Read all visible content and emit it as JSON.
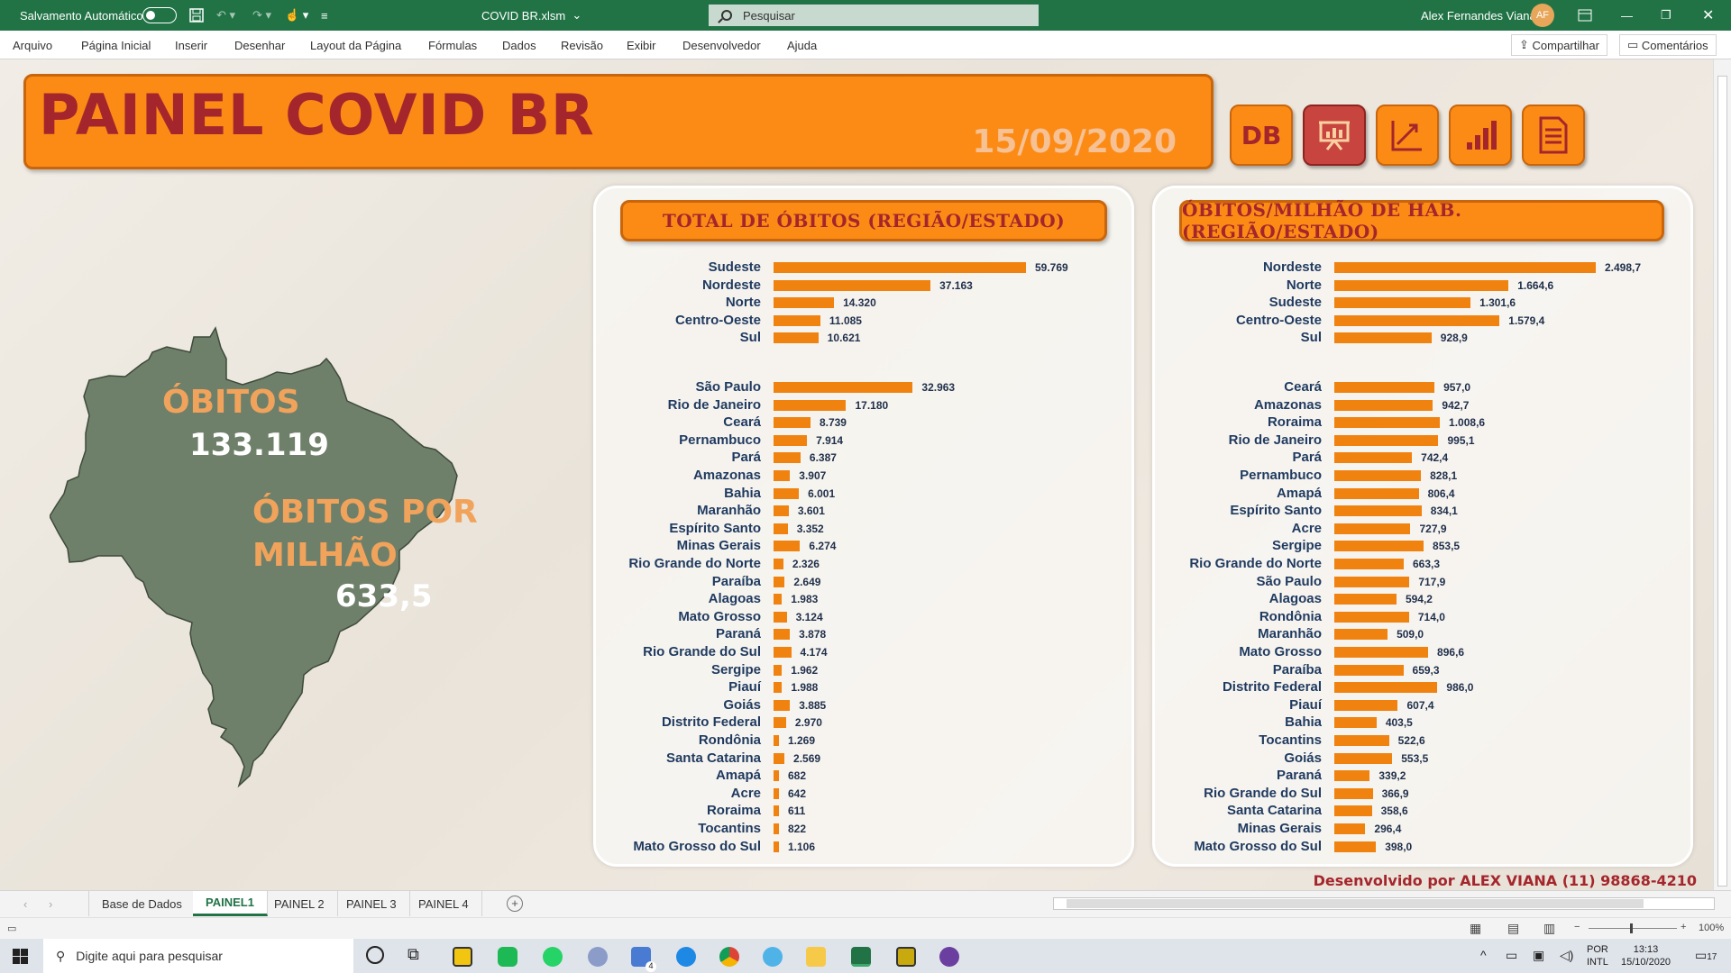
{
  "window": {
    "autosave_label": "Salvamento Automático",
    "file_name": "COVID BR.xlsm",
    "search_placeholder": "Pesquisar",
    "user_name": "Alex Fernandes Viana",
    "user_initials": "AF"
  },
  "ribbon": {
    "tabs": [
      "Arquivo",
      "Página Inicial",
      "Inserir",
      "Desenhar",
      "Layout da Página",
      "Fórmulas",
      "Dados",
      "Revisão",
      "Exibir",
      "Desenvolvedor",
      "Ajuda"
    ],
    "share_label": "Compartilhar",
    "comments_label": "Comentários"
  },
  "dashboard": {
    "title": "PAINEL COVID BR",
    "date": "15/09/2020",
    "db_button": "DB",
    "map": {
      "deaths_label": "ÓBITOS",
      "deaths_value": "133.119",
      "per_million_label_1": "ÓBITOS POR",
      "per_million_label_2": "MILHÃO",
      "per_million_value": "633,5"
    },
    "credit": "Desenvolvido por ALEX VIANA (11) 98868-4210"
  },
  "chart_data": [
    {
      "type": "bar",
      "title": "TOTAL DE ÓBITOS (REGIÃO/ESTADO)",
      "orientation": "horizontal",
      "regions": {
        "categories": [
          "Sudeste",
          "Nordeste",
          "Norte",
          "Centro-Oeste",
          "Sul"
        ],
        "values": [
          59769,
          37163,
          14320,
          11085,
          10621
        ],
        "labels": [
          "59.769",
          "37.163",
          "14.320",
          "11.085",
          "10.621"
        ]
      },
      "states": {
        "categories": [
          "São Paulo",
          "Rio de Janeiro",
          "Ceará",
          "Pernambuco",
          "Pará",
          "Amazonas",
          "Bahia",
          "Maranhão",
          "Espírito Santo",
          "Minas Gerais",
          "Rio Grande do Norte",
          "Paraíba",
          "Alagoas",
          "Mato Grosso",
          "Paraná",
          "Rio Grande do Sul",
          "Sergipe",
          "Piauí",
          "Goiás",
          "Distrito Federal",
          "Rondônia",
          "Santa Catarina",
          "Amapá",
          "Acre",
          "Roraima",
          "Tocantins",
          "Mato Grosso do Sul"
        ],
        "values": [
          32963,
          17180,
          8739,
          7914,
          6387,
          3907,
          6001,
          3601,
          3352,
          6274,
          2326,
          2649,
          1983,
          3124,
          3878,
          4174,
          1962,
          1988,
          3885,
          2970,
          1269,
          2569,
          682,
          642,
          611,
          822,
          1106
        ],
        "labels": [
          "32.963",
          "17.180",
          "8.739",
          "7.914",
          "6.387",
          "3.907",
          "6.001",
          "3.601",
          "3.352",
          "6.274",
          "2.326",
          "2.649",
          "1.983",
          "3.124",
          "3.878",
          "4.174",
          "1.962",
          "1.988",
          "3.885",
          "2.970",
          "1.269",
          "2.569",
          "682",
          "642",
          "611",
          "822",
          "1.106"
        ]
      }
    },
    {
      "type": "bar",
      "title": "ÓBITOS/MILHÃO DE HAB. (REGIÃO/ESTADO)",
      "orientation": "horizontal",
      "regions": {
        "categories": [
          "Nordeste",
          "Norte",
          "Sudeste",
          "Centro-Oeste",
          "Sul"
        ],
        "values": [
          2498.7,
          1664.6,
          1301.6,
          1579.4,
          928.9
        ],
        "labels": [
          "2.498,7",
          "1.664,6",
          "1.301,6",
          "1.579,4",
          "928,9"
        ]
      },
      "states": {
        "categories": [
          "Ceará",
          "Amazonas",
          "Roraima",
          "Rio de Janeiro",
          "Pará",
          "Pernambuco",
          "Amapá",
          "Espírito Santo",
          "Acre",
          "Sergipe",
          "Rio Grande do Norte",
          "São Paulo",
          "Alagoas",
          "Rondônia",
          "Maranhão",
          "Mato Grosso",
          "Paraíba",
          "Distrito Federal",
          "Piauí",
          "Bahia",
          "Tocantins",
          "Goiás",
          "Paraná",
          "Rio Grande do Sul",
          "Santa Catarina",
          "Minas Gerais",
          "Mato Grosso do Sul"
        ],
        "values": [
          957.0,
          942.7,
          1008.6,
          995.1,
          742.4,
          828.1,
          806.4,
          834.1,
          727.9,
          853.5,
          663.3,
          717.9,
          594.2,
          714.0,
          509.0,
          896.6,
          659.3,
          986.0,
          607.4,
          403.5,
          522.6,
          553.5,
          339.2,
          366.9,
          358.6,
          296.4,
          398.0
        ],
        "labels": [
          "957,0",
          "942,7",
          "1.008,6",
          "995,1",
          "742,4",
          "828,1",
          "806,4",
          "834,1",
          "727,9",
          "853,5",
          "663,3",
          "717,9",
          "594,2",
          "714,0",
          "509,0",
          "896,6",
          "659,3",
          "986,0",
          "607,4",
          "403,5",
          "522,6",
          "553,5",
          "339,2",
          "366,9",
          "358,6",
          "296,4",
          "398,0"
        ]
      }
    }
  ],
  "sheet_tabs": [
    "Base de Dados",
    "PAINEL1",
    "PAINEL 2",
    "PAINEL 3",
    "PAINEL 4"
  ],
  "zoom": "100%",
  "taskbar": {
    "search_placeholder": "Digite aqui para pesquisar",
    "lang_1": "POR",
    "lang_2": "INTL",
    "time": "13:13",
    "date": "15/10/2020",
    "notifications": "17",
    "mail_badge": "4"
  }
}
